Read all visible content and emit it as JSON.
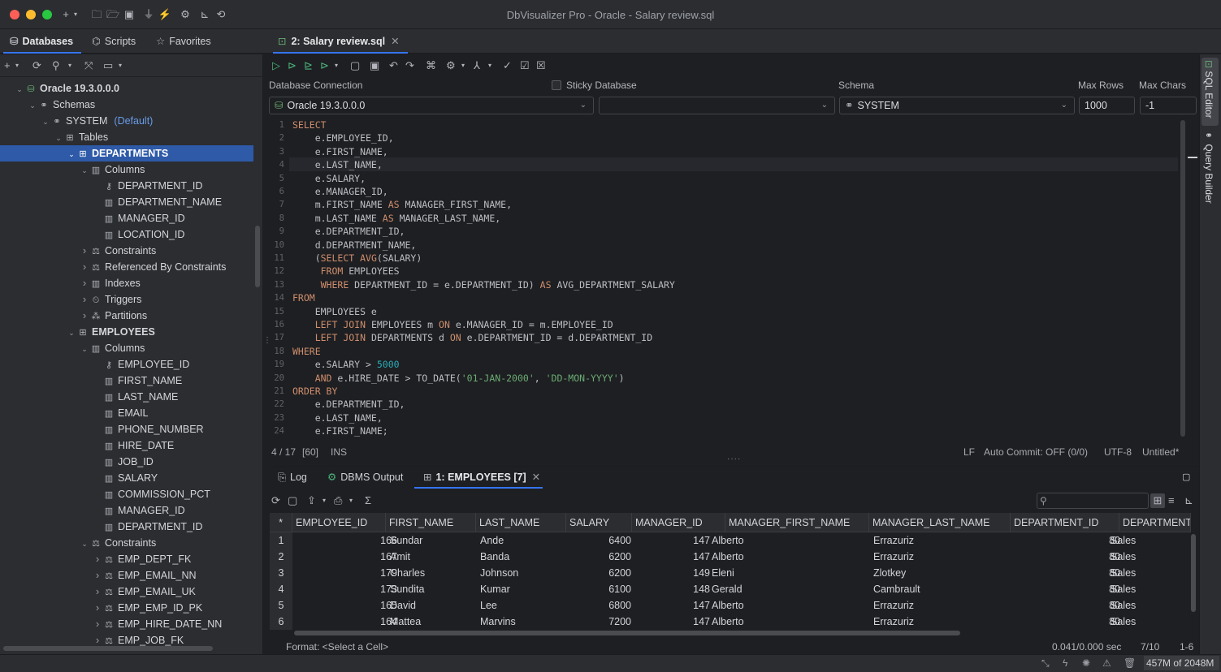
{
  "window": {
    "title": "DbVisualizer Pro - Oracle - Salary review.sql"
  },
  "nav_tabs": [
    {
      "label": "Databases",
      "icon": "database-icon"
    },
    {
      "label": "Scripts",
      "icon": "scripts-icon"
    },
    {
      "label": "Favorites",
      "icon": "star-icon"
    }
  ],
  "editor_tab": {
    "label": "2: Salary review.sql"
  },
  "tree": [
    {
      "level": 0,
      "chev": "down",
      "icon": "db",
      "label": "Oracle 19.3.0.0.0",
      "bold": true
    },
    {
      "level": 1,
      "chev": "down",
      "icon": "schemas",
      "label": "Schemas"
    },
    {
      "level": 2,
      "chev": "down",
      "icon": "schema",
      "label": "SYSTEM",
      "extra": "(Default)"
    },
    {
      "level": 3,
      "chev": "down",
      "icon": "table",
      "label": "Tables"
    },
    {
      "level": 4,
      "chev": "down",
      "icon": "table",
      "label": "DEPARTMENTS",
      "bold": true,
      "selected": true
    },
    {
      "level": 5,
      "chev": "down",
      "icon": "columns",
      "label": "Columns"
    },
    {
      "level": 6,
      "chev": "",
      "icon": "key",
      "label": "DEPARTMENT_ID"
    },
    {
      "level": 6,
      "chev": "",
      "icon": "column",
      "label": "DEPARTMENT_NAME"
    },
    {
      "level": 6,
      "chev": "",
      "icon": "column",
      "label": "MANAGER_ID"
    },
    {
      "level": 6,
      "chev": "",
      "icon": "column",
      "label": "LOCATION_ID"
    },
    {
      "level": 5,
      "chev": "right",
      "icon": "constraint",
      "label": "Constraints"
    },
    {
      "level": 5,
      "chev": "right",
      "icon": "constraint",
      "label": "Referenced By Constraints"
    },
    {
      "level": 5,
      "chev": "right",
      "icon": "columns",
      "label": "Indexes"
    },
    {
      "level": 5,
      "chev": "right",
      "icon": "trigger",
      "label": "Triggers"
    },
    {
      "level": 5,
      "chev": "right",
      "icon": "partition",
      "label": "Partitions"
    },
    {
      "level": 4,
      "chev": "down",
      "icon": "table",
      "label": "EMPLOYEES",
      "bold": true
    },
    {
      "level": 5,
      "chev": "down",
      "icon": "columns",
      "label": "Columns"
    },
    {
      "level": 6,
      "chev": "",
      "icon": "key",
      "label": "EMPLOYEE_ID"
    },
    {
      "level": 6,
      "chev": "",
      "icon": "column",
      "label": "FIRST_NAME"
    },
    {
      "level": 6,
      "chev": "",
      "icon": "column",
      "label": "LAST_NAME"
    },
    {
      "level": 6,
      "chev": "",
      "icon": "column",
      "label": "EMAIL"
    },
    {
      "level": 6,
      "chev": "",
      "icon": "column",
      "label": "PHONE_NUMBER"
    },
    {
      "level": 6,
      "chev": "",
      "icon": "column",
      "label": "HIRE_DATE"
    },
    {
      "level": 6,
      "chev": "",
      "icon": "column",
      "label": "JOB_ID"
    },
    {
      "level": 6,
      "chev": "",
      "icon": "column",
      "label": "SALARY"
    },
    {
      "level": 6,
      "chev": "",
      "icon": "column",
      "label": "COMMISSION_PCT"
    },
    {
      "level": 6,
      "chev": "",
      "icon": "column",
      "label": "MANAGER_ID"
    },
    {
      "level": 6,
      "chev": "",
      "icon": "column",
      "label": "DEPARTMENT_ID"
    },
    {
      "level": 5,
      "chev": "down",
      "icon": "constraint",
      "label": "Constraints"
    },
    {
      "level": 6,
      "chev": "right",
      "icon": "constraint",
      "label": "EMP_DEPT_FK"
    },
    {
      "level": 6,
      "chev": "right",
      "icon": "constraint",
      "label": "EMP_EMAIL_NN"
    },
    {
      "level": 6,
      "chev": "right",
      "icon": "constraint",
      "label": "EMP_EMAIL_UK"
    },
    {
      "level": 6,
      "chev": "right",
      "icon": "constraint",
      "label": "EMP_EMP_ID_PK"
    },
    {
      "level": 6,
      "chev": "right",
      "icon": "constraint",
      "label": "EMP_HIRE_DATE_NN"
    },
    {
      "level": 6,
      "chev": "right",
      "icon": "constraint",
      "label": "EMP_JOB_FK"
    }
  ],
  "connection": {
    "db_label": "Database Connection",
    "db_value": "Oracle 19.3.0.0.0",
    "sticky_label": "Sticky Database",
    "schema_label": "Schema",
    "schema_value": "SYSTEM",
    "maxrows_label": "Max Rows",
    "maxrows_value": "1000",
    "maxchars_label": "Max Chars",
    "maxchars_value": "-1"
  },
  "code_lines": [
    [
      {
        "t": "SELECT",
        "c": "kw"
      }
    ],
    [
      {
        "t": "    e.EMPLOYEE_ID,"
      }
    ],
    [
      {
        "t": "    e.FIRST_NAME,"
      }
    ],
    [
      {
        "t": "    e.LAST_NAME,"
      }
    ],
    [
      {
        "t": "    e.SALARY,"
      }
    ],
    [
      {
        "t": "    e.MANAGER_ID,"
      }
    ],
    [
      {
        "t": "    m.FIRST_NAME "
      },
      {
        "t": "AS",
        "c": "kw"
      },
      {
        "t": " MANAGER_FIRST_NAME,"
      }
    ],
    [
      {
        "t": "    m.LAST_NAME "
      },
      {
        "t": "AS",
        "c": "kw"
      },
      {
        "t": " MANAGER_LAST_NAME,"
      }
    ],
    [
      {
        "t": "    e.DEPARTMENT_ID,"
      }
    ],
    [
      {
        "t": "    d.DEPARTMENT_NAME,"
      }
    ],
    [
      {
        "t": "    ("
      },
      {
        "t": "SELECT",
        "c": "kw"
      },
      {
        "t": " "
      },
      {
        "t": "AVG",
        "c": "kw"
      },
      {
        "t": "(SALARY)"
      }
    ],
    [
      {
        "t": "     "
      },
      {
        "t": "FROM",
        "c": "kw"
      },
      {
        "t": " EMPLOYEES"
      }
    ],
    [
      {
        "t": "     "
      },
      {
        "t": "WHERE",
        "c": "kw"
      },
      {
        "t": " DEPARTMENT_ID = e.DEPARTMENT_ID) "
      },
      {
        "t": "AS",
        "c": "kw"
      },
      {
        "t": " AVG_DEPARTMENT_SALARY"
      }
    ],
    [
      {
        "t": "FROM",
        "c": "kw"
      }
    ],
    [
      {
        "t": "    EMPLOYEES e"
      }
    ],
    [
      {
        "t": "    "
      },
      {
        "t": "LEFT JOIN",
        "c": "kw"
      },
      {
        "t": " EMPLOYEES m "
      },
      {
        "t": "ON",
        "c": "kw"
      },
      {
        "t": " e.MANAGER_ID = m.EMPLOYEE_ID"
      }
    ],
    [
      {
        "t": "    "
      },
      {
        "t": "LEFT JOIN",
        "c": "kw"
      },
      {
        "t": " DEPARTMENTS d "
      },
      {
        "t": "ON",
        "c": "kw"
      },
      {
        "t": " e.DEPARTMENT_ID = d.DEPARTMENT_ID"
      }
    ],
    [
      {
        "t": "WHERE",
        "c": "kw"
      }
    ],
    [
      {
        "t": "    e.SALARY > "
      },
      {
        "t": "5000",
        "c": "num"
      }
    ],
    [
      {
        "t": "    "
      },
      {
        "t": "AND",
        "c": "kw"
      },
      {
        "t": " e.HIRE_DATE > TO_DATE("
      },
      {
        "t": "'01-JAN-2000'",
        "c": "str"
      },
      {
        "t": ", "
      },
      {
        "t": "'DD-MON-YYYY'",
        "c": "str"
      },
      {
        "t": ")"
      }
    ],
    [
      {
        "t": "ORDER BY",
        "c": "kw"
      }
    ],
    [
      {
        "t": "    e.DEPARTMENT_ID,"
      }
    ],
    [
      {
        "t": "    e.LAST_NAME,"
      }
    ],
    [
      {
        "t": "    e.FIRST_NAME;"
      }
    ]
  ],
  "editor_status": {
    "position": "4 / 17",
    "length": "[60]",
    "mode": "INS",
    "line_ending": "LF",
    "auto_commit": "Auto Commit: OFF (0/0)",
    "encoding": "UTF-8",
    "untitled": "Untitled*"
  },
  "side_tabs": {
    "sql_editor": "SQL Editor",
    "query_builder": "Query Builder"
  },
  "bottom_tabs": [
    {
      "label": "Log"
    },
    {
      "label": "DBMS Output"
    },
    {
      "label": "1: EMPLOYEES [7]"
    }
  ],
  "grid": {
    "row_header": "*",
    "columns": [
      "EMPLOYEE_ID",
      "FIRST_NAME",
      "LAST_NAME",
      "SALARY",
      "MANAGER_ID",
      "MANAGER_FIRST_NAME",
      "MANAGER_LAST_NAME",
      "DEPARTMENT_ID",
      "DEPARTMENT_"
    ],
    "rows": [
      [
        "1",
        "166",
        "Sundar",
        "Ande",
        "6400",
        "147",
        "Alberto",
        "Errazuriz",
        "80",
        "Sales"
      ],
      [
        "2",
        "167",
        "Amit",
        "Banda",
        "6200",
        "147",
        "Alberto",
        "Errazuriz",
        "80",
        "Sales"
      ],
      [
        "3",
        "179",
        "Charles",
        "Johnson",
        "6200",
        "149",
        "Eleni",
        "Zlotkey",
        "80",
        "Sales"
      ],
      [
        "4",
        "173",
        "Sundita",
        "Kumar",
        "6100",
        "148",
        "Gerald",
        "Cambrault",
        "80",
        "Sales"
      ],
      [
        "5",
        "165",
        "David",
        "Lee",
        "6800",
        "147",
        "Alberto",
        "Errazuriz",
        "80",
        "Sales"
      ],
      [
        "6",
        "164",
        "Mattea",
        "Marvins",
        "7200",
        "147",
        "Alberto",
        "Errazuriz",
        "80",
        "Sales"
      ]
    ]
  },
  "result_status": {
    "format": "Format: <Select a Cell>",
    "timing": "0.041/0.000 sec",
    "rows": "7/10",
    "range": "1-6"
  },
  "memory": "457M of 2048M",
  "colors": {
    "accent": "#3574f0",
    "selection": "#2e5aa8",
    "keyword": "#cf8e6d",
    "string": "#6aab73",
    "number": "#2aacb8"
  }
}
